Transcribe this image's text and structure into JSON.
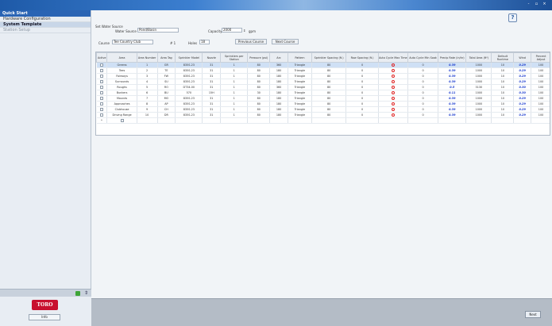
{
  "window": {
    "controls": [
      "-",
      "▫",
      "×"
    ]
  },
  "sidebar": {
    "header": "Quick Start",
    "items": [
      {
        "label": "Hardware Configuration"
      },
      {
        "label": "System Template"
      },
      {
        "label": "Station Setup"
      }
    ]
  },
  "brand": {
    "logo": "TORO",
    "button_label": "Info"
  },
  "form": {
    "group_title": "Set Water Source",
    "water_source_label": "Water Source",
    "water_source_value": "Pond/Basin",
    "capacity_label": "Capacity",
    "capacity_value": "2000",
    "capacity_unit": "gpm",
    "course_label": "Course",
    "course_value": "Tee Country Club",
    "holes_prefix": "# 1",
    "holes_label": "Holes",
    "holes_value": "18",
    "previous_course": "Previous Course",
    "next_course": "Next Course"
  },
  "grid": {
    "columns": [
      "Active",
      "Area",
      "Area Number",
      "Area Tag",
      "Sprinkler Model",
      "Nozzle",
      "Sprinklers per Station",
      "Pressure (psi)",
      "Arc",
      "Pattern",
      "Sprinkler Spacing (ft.)",
      "Row Spacing (ft.)",
      "Auto Cycle Max Time",
      "Auto Cycle Min Soak",
      "Precip Rate (in/hr)",
      "Total Area (ft²)",
      "Default Runtime",
      "Wind",
      "Percent Adjust"
    ],
    "rows": [
      [
        "",
        "Greens",
        "1",
        "GR",
        "835S-23",
        "31",
        "1",
        "80",
        "360",
        "Triangle",
        "80",
        "0",
        "",
        "0",
        "0.39",
        "1000",
        "10",
        "0.29",
        "100"
      ],
      [
        "",
        "Tees",
        "2",
        "TE",
        "835S-23",
        "31",
        "1",
        "80",
        "180",
        "Triangle",
        "80",
        "0",
        "",
        "0",
        "0.39",
        "1000",
        "10",
        "0.29",
        "100"
      ],
      [
        "",
        "Fairways",
        "3",
        "FW",
        "835S-23",
        "31",
        "1",
        "80",
        "180",
        "Triangle",
        "80",
        "0",
        "",
        "0",
        "0.39",
        "1000",
        "10",
        "0.29",
        "100"
      ],
      [
        "",
        "Surrounds",
        "4",
        "SU",
        "835S-23",
        "31",
        "1",
        "80",
        "180",
        "Triangle",
        "80",
        "0",
        "",
        "0",
        "0.39",
        "1000",
        "10",
        "0.29",
        "100"
      ],
      [
        "",
        "Roughs",
        "5",
        "RO",
        "DT34-00",
        "31",
        "1",
        "80",
        "360",
        "Triangle",
        "80",
        "0",
        "",
        "0",
        "0.5",
        "3130",
        "10",
        "0.30",
        "100"
      ],
      [
        "",
        "Bunkers",
        "6",
        "BU",
        "570",
        "15H",
        "1",
        "30",
        "180",
        "Triangle",
        "80",
        "0",
        "",
        "0",
        "0.11",
        "1000",
        "10",
        "0.30",
        "100"
      ],
      [
        "",
        "Mounds",
        "7",
        "MO",
        "835S-23",
        "31",
        "1",
        "80",
        "180",
        "Triangle",
        "80",
        "0",
        "",
        "0",
        "0.39",
        "1000",
        "10",
        "0.29",
        "100"
      ],
      [
        "",
        "Approaches",
        "8",
        "AP",
        "835S-23",
        "31",
        "1",
        "80",
        "180",
        "Triangle",
        "80",
        "0",
        "",
        "0",
        "0.39",
        "1000",
        "10",
        "0.29",
        "100"
      ],
      [
        "",
        "Clubhouse",
        "9",
        "CH",
        "835S-23",
        "31",
        "1",
        "80",
        "180",
        "Triangle",
        "80",
        "0",
        "",
        "0",
        "0.39",
        "1000",
        "10",
        "0.29",
        "100"
      ],
      [
        "",
        "Driving Range",
        "10",
        "DR",
        "835S-23",
        "31",
        "1",
        "80",
        "180",
        "Triangle",
        "80",
        "0",
        "",
        "0",
        "0.39",
        "1000",
        "10",
        "0.29",
        "100"
      ]
    ],
    "new_row_marker": "*"
  },
  "footer": {
    "next_label": "Next"
  },
  "colors": {
    "accent": "#2a64b4",
    "brand_red": "#c8102e",
    "selection": "#cfe0f5"
  }
}
